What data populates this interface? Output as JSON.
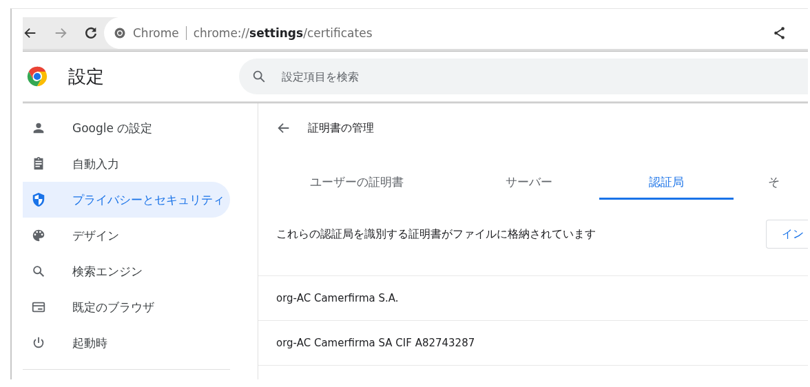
{
  "toolbar": {
    "site_label": "Chrome",
    "url": "chrome://**settings**/certificates"
  },
  "header": {
    "title": "設定",
    "search": {
      "placeholder": "設定項目を検索"
    }
  },
  "sidebar": {
    "items": [
      {
        "label": "Google の設定",
        "kind": "person",
        "selected": false
      },
      {
        "label": "自動入力",
        "kind": "clipboard",
        "selected": false
      },
      {
        "label": "プライバシーとセキュリティ",
        "kind": "shield",
        "selected": true
      },
      {
        "label": "デザイン",
        "kind": "palette",
        "selected": false
      },
      {
        "label": "検索エンジン",
        "kind": "search",
        "selected": false
      },
      {
        "label": "既定のブラウザ",
        "kind": "browser",
        "selected": false
      },
      {
        "label": "起動時",
        "kind": "power",
        "selected": false
      }
    ]
  },
  "page": {
    "title": "証明書の管理",
    "tabs": [
      {
        "label": "ユーザーの証明書",
        "selected": false
      },
      {
        "label": "サーバー",
        "selected": false
      },
      {
        "label": "認証局",
        "selected": true
      },
      {
        "label": "そ",
        "selected": false
      }
    ],
    "description": "これらの認証局を識別する証明書がファイルに格納されています",
    "import_button": "イン",
    "certificates": [
      {
        "name": "org-AC Camerfirma S.A."
      },
      {
        "name": "org-AC Camerfirma SA CIF A82743287"
      }
    ]
  }
}
